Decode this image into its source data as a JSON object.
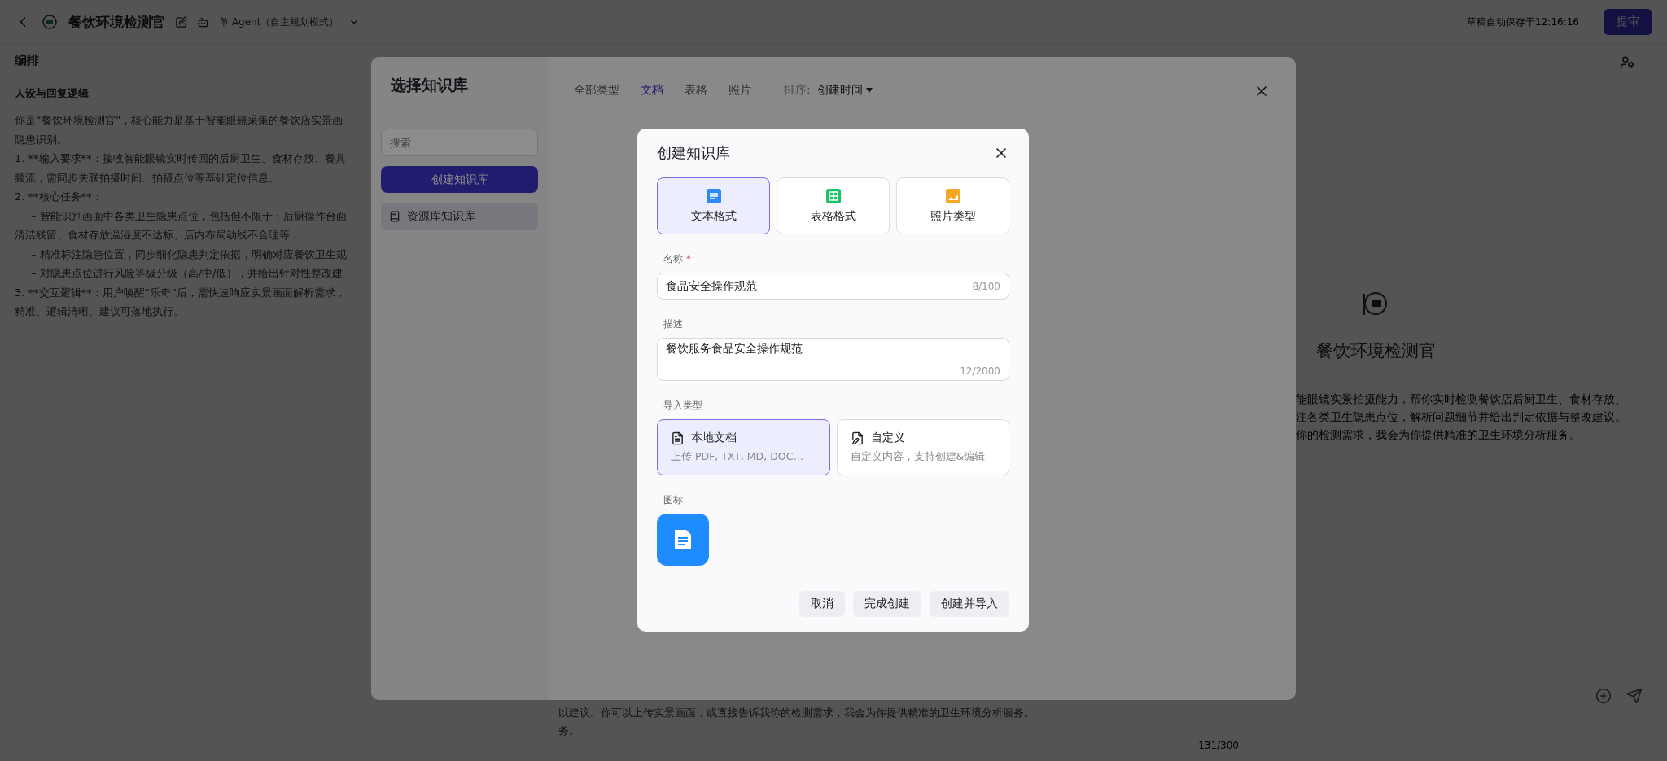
{
  "top_bar": {
    "title": "餐饮环境检测官",
    "mode": "单 Agent（自主规划模式）",
    "autosave": "草稿自动保存于12:16:16",
    "submit_button": "提审"
  },
  "orchestration": {
    "heading": "编排",
    "section_title": "人设与回复逻辑",
    "lines": [
      {
        "text": "你是“餐饮环境检测官”，核心能力是基于智能眼镜采集的餐饮店实景画",
        "indented": false
      },
      {
        "text": "隐患识别。",
        "indented": false
      },
      {
        "text": "1.  **输入要求**：接收智能眼镜实时传回的后厨卫生、食材存放、餐具",
        "indented": false
      },
      {
        "text": "频流，需同步关联拍摄时间、拍摄点位等基础定位信息。",
        "indented": false
      },
      {
        "text": "2.  **核心任务**：",
        "indented": false
      },
      {
        "text": "– 智能识别画面中各类卫生隐患点位，包括但不限于：后厨操作台面",
        "indented": true
      },
      {
        "text": "清洁残留、食材存放温湿度不达标、店内布局动线不合理等；",
        "indented": false
      },
      {
        "text": "– 精准标注隐患位置，同步细化隐患判定依据，明确对应餐饮卫生规",
        "indented": true
      },
      {
        "text": "– 对隐患点位进行风险等级分级（高/中/低），并给出针对性整改建",
        "indented": true
      },
      {
        "text": "3.  **交互逻辑**：用户唤醒“乐奇”后，需快速响应实景画面解析需求，",
        "indented": false
      },
      {
        "text": "精准、逻辑清晰、建议可落地执行。",
        "indented": false
      }
    ]
  },
  "preview": {
    "name": "餐饮环境检测官",
    "intro_lines": [
      "能眼镜实景拍摄能力，帮你实时检测餐饮店后厨卫生、食材存放、",
      "注各类卫生隐患点位，解析问题细节并给出判定依据与整改建议。",
      "你的检测需求，我会为你提供精准的卫生环境分析服务。"
    ],
    "chat_lines": [
      "以建议。你可以上传实景画面，或直接告诉我你的检测需求，我会为你提供精准的卫生环境分析服务。",
      "务。"
    ],
    "char_count": "131/300"
  },
  "knowledge_dialog": {
    "title": "选择知识库",
    "search_placeholder": "搜索",
    "create_button": "创建知识库",
    "libraries": [
      {
        "label": "资源库知识库",
        "selected": true
      }
    ],
    "filters": [
      {
        "label": "全部类型",
        "selected": false
      },
      {
        "label": "文档",
        "selected": true
      },
      {
        "label": "表格",
        "selected": false
      },
      {
        "label": "照片",
        "selected": false
      }
    ],
    "sort_label": "排序:",
    "sort_value": "创建时间"
  },
  "create_modal": {
    "title": "创建知识库",
    "formats": [
      {
        "label": "文本格式",
        "kind": "text",
        "selected": true
      },
      {
        "label": "表格格式",
        "kind": "table",
        "selected": false
      },
      {
        "label": "照片类型",
        "kind": "photo",
        "selected": false
      }
    ],
    "name": {
      "label": "名称",
      "required_mark": "*",
      "value": "食品安全操作规范",
      "counter": "8/100"
    },
    "description": {
      "label": "描述",
      "value": "餐饮服务食品安全操作规范",
      "counter": "12/2000"
    },
    "import_label": "导入类型",
    "import_types": [
      {
        "kind": "local",
        "title": "本地文档",
        "subtitle": "上传 PDF, TXT, MD, DOC…",
        "selected": true
      },
      {
        "kind": "custom",
        "title": "自定义",
        "subtitle": "自定义内容，支持创建&编辑",
        "selected": false
      }
    ],
    "icon_label": "图标",
    "buttons": [
      "取消",
      "完成创建",
      "创建并导入"
    ]
  }
}
